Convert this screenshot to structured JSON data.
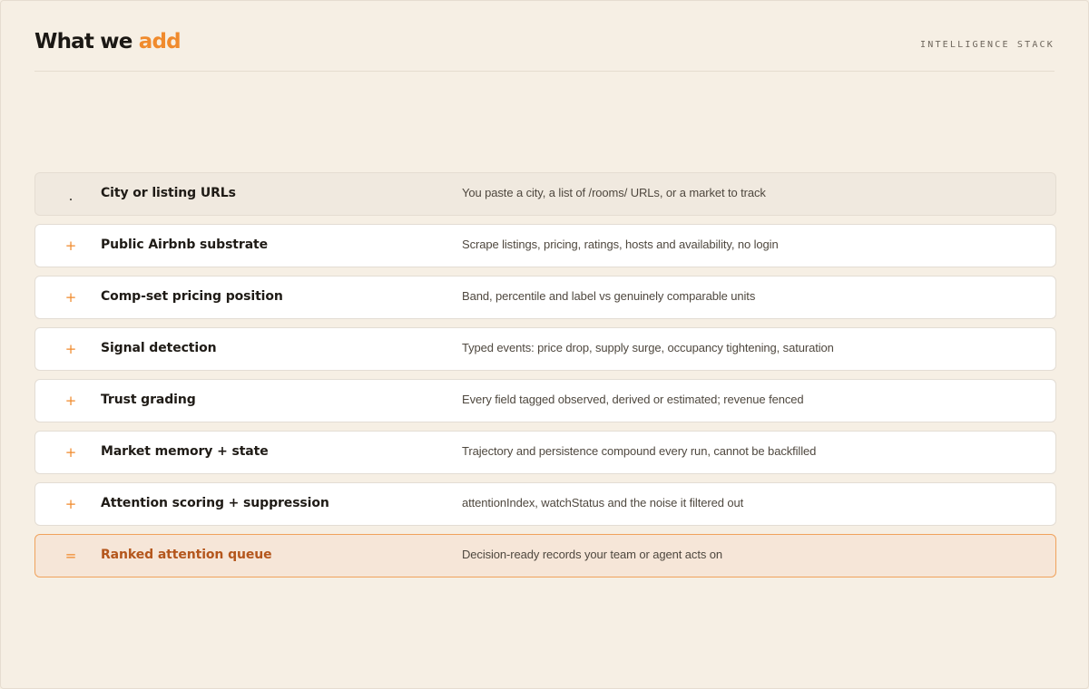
{
  "header": {
    "title_prefix": "What we ",
    "title_accent": "add",
    "kicker": "INTELLIGENCE STACK"
  },
  "colors": {
    "background": "#f6efe4",
    "accent": "#f08a2c",
    "output_text": "#b4561c",
    "output_border": "#f0a25c"
  },
  "rows": [
    {
      "kind": "input",
      "marker": ".",
      "label": "City or listing URLs",
      "desc": "You paste a city, a list of /rooms/ URLs, or a market to track"
    },
    {
      "kind": "layer",
      "marker": "+",
      "label": "Public Airbnb substrate",
      "desc": "Scrape listings, pricing, ratings, hosts and availability, no login"
    },
    {
      "kind": "layer",
      "marker": "+",
      "label": "Comp-set pricing position",
      "desc": "Band, percentile and label vs genuinely comparable units"
    },
    {
      "kind": "layer",
      "marker": "+",
      "label": "Signal detection",
      "desc": "Typed events: price drop, supply surge, occupancy tightening, saturation"
    },
    {
      "kind": "layer",
      "marker": "+",
      "label": "Trust grading",
      "desc": "Every field tagged observed, derived or estimated; revenue fenced"
    },
    {
      "kind": "layer",
      "marker": "+",
      "label": "Market memory + state",
      "desc": "Trajectory and persistence compound every run, cannot be backfilled"
    },
    {
      "kind": "layer",
      "marker": "+",
      "label": "Attention scoring + suppression",
      "desc": "attentionIndex, watchStatus and the noise it filtered out"
    },
    {
      "kind": "output",
      "marker": "=",
      "label": "Ranked attention queue",
      "desc": "Decision-ready records your team or agent acts on"
    }
  ]
}
